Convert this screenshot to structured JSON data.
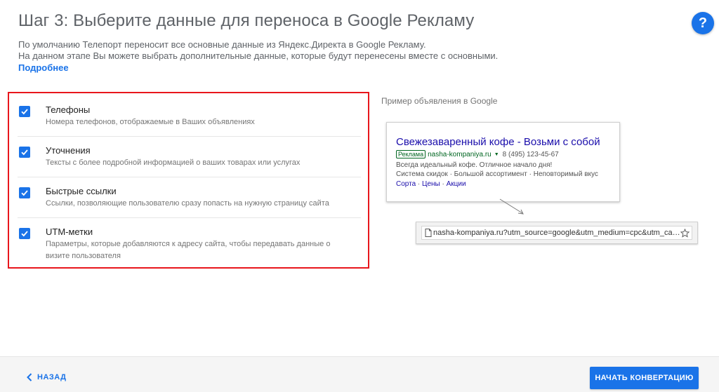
{
  "header": {
    "title": "Шаг 3: Выберите данные для переноса в Google Рекламу",
    "help_label": "?"
  },
  "description": {
    "line1": "По умолчанию Телепорт переносит все основные данные из Яндекс.Директа в Google Рекламу.",
    "line2": "На данном этапе Вы можете выбрать дополнительные данные, которые будут перенесены вместе с основными.",
    "more_link": "Подробнее"
  },
  "options": [
    {
      "title": "Телефоны",
      "subtitle": "Номера телефонов, отображаемые в Ваших объявлениях",
      "checked": true
    },
    {
      "title": "Уточнения",
      "subtitle": "Тексты с более подробной информацией о ваших товарах или услугах",
      "checked": true
    },
    {
      "title": "Быстрые ссылки",
      "subtitle": "Ссылки, позволяющие пользователю сразу попасть на нужную страницу сайта",
      "checked": true
    },
    {
      "title": "UTM-метки",
      "subtitle": "Параметры, которые добавляются к адресу сайта, чтобы передавать данные о визите пользователя",
      "checked": true
    }
  ],
  "example": {
    "label": "Пример объявления в Google",
    "ad": {
      "title": "Свежезаваренный кофе - Возьми с собой",
      "badge": "Реклама",
      "display_url": "nasha-kompaniya.ru",
      "phone": "8 (495) 123-45-67",
      "text1": "Всегда идеальный кофе. Отличное начало дня!",
      "text2": "Система скидок · Большой ассортимент · Неповторимый вкус",
      "sitelinks": [
        "Сорта",
        "Цены",
        "Акции"
      ]
    },
    "browser_url": "nasha-kompaniya.ru?utm_source=google&utm_medium=cpc&utm_campaign=..."
  },
  "footer": {
    "back_label": "НАЗАД",
    "start_label": "НАЧАТЬ КОНВЕРТАЦИЮ"
  },
  "colors": {
    "accent": "#1a73e8",
    "highlight_border": "#e8161c",
    "ad_title": "#1a0dab",
    "ad_url": "#006621"
  }
}
